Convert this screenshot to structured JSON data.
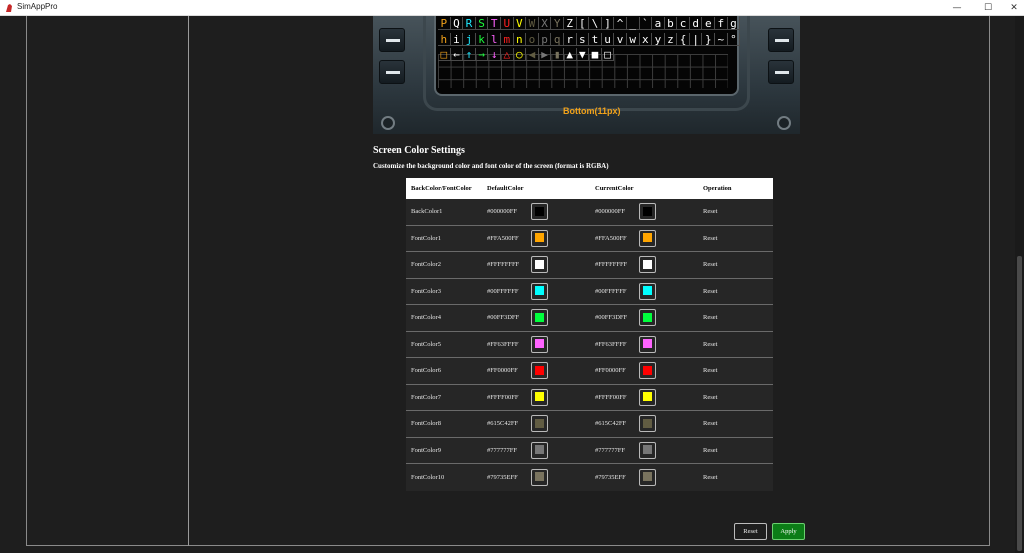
{
  "window": {
    "title": "SimAppPro",
    "min_symbol": "—",
    "max_symbol": "☐",
    "close_symbol": "✕"
  },
  "device": {
    "bottom_label": "Bottom(11px)",
    "char_rows": [
      [
        {
          "c": "P",
          "color": "#f2a21a"
        },
        {
          "c": "Q",
          "color": "#ffffff"
        },
        {
          "c": "R",
          "color": "#1fe8ff"
        },
        {
          "c": "S",
          "color": "#1cff3d"
        },
        {
          "c": "T",
          "color": "#ff63ff"
        },
        {
          "c": "U",
          "color": "#ff2020"
        },
        {
          "c": "V",
          "color": "#ffff00"
        },
        {
          "c": "W",
          "color": "#615c42"
        },
        {
          "c": "X",
          "color": "#777777"
        },
        {
          "c": "Y",
          "color": "#79735e"
        },
        {
          "c": "Z",
          "color": "#ffffff"
        },
        {
          "c": "[",
          "color": "#ffffff"
        },
        {
          "c": "\\",
          "color": "#ffffff"
        },
        {
          "c": "]",
          "color": "#ffffff"
        },
        {
          "c": "^",
          "color": "#ffffff"
        },
        {
          "c": "_",
          "color": "#ffffff"
        },
        {
          "c": "`",
          "color": "#ffffff"
        },
        {
          "c": "a",
          "color": "#ffffff"
        },
        {
          "c": "b",
          "color": "#ffffff"
        },
        {
          "c": "c",
          "color": "#ffffff"
        },
        {
          "c": "d",
          "color": "#ffffff"
        },
        {
          "c": "e",
          "color": "#ffffff"
        },
        {
          "c": "f",
          "color": "#ffffff"
        },
        {
          "c": "g",
          "color": "#ffffff"
        }
      ],
      [
        {
          "c": "h",
          "color": "#f2a21a"
        },
        {
          "c": "i",
          "color": "#ffffff"
        },
        {
          "c": "j",
          "color": "#1fe8ff"
        },
        {
          "c": "k",
          "color": "#1cff3d"
        },
        {
          "c": "l",
          "color": "#ff63ff"
        },
        {
          "c": "m",
          "color": "#ff2020"
        },
        {
          "c": "n",
          "color": "#ffff00"
        },
        {
          "c": "o",
          "color": "#615c42"
        },
        {
          "c": "p",
          "color": "#777777"
        },
        {
          "c": "q",
          "color": "#79735e"
        },
        {
          "c": "r",
          "color": "#ffffff"
        },
        {
          "c": "s",
          "color": "#ffffff"
        },
        {
          "c": "t",
          "color": "#ffffff"
        },
        {
          "c": "u",
          "color": "#ffffff"
        },
        {
          "c": "v",
          "color": "#ffffff"
        },
        {
          "c": "w",
          "color": "#ffffff"
        },
        {
          "c": "x",
          "color": "#ffffff"
        },
        {
          "c": "y",
          "color": "#ffffff"
        },
        {
          "c": "z",
          "color": "#ffffff"
        },
        {
          "c": "{",
          "color": "#ffffff"
        },
        {
          "c": "|",
          "color": "#ffffff"
        },
        {
          "c": "}",
          "color": "#ffffff"
        },
        {
          "c": "~",
          "color": "#ffffff"
        },
        {
          "c": "°",
          "color": "#ffffff"
        }
      ],
      [
        {
          "c": "□",
          "color": "#f2a21a"
        },
        {
          "c": "←",
          "color": "#ffffff"
        },
        {
          "c": "↑",
          "color": "#1fe8ff"
        },
        {
          "c": "→",
          "color": "#1cff3d"
        },
        {
          "c": "↓",
          "color": "#ff63ff"
        },
        {
          "c": "△",
          "color": "#ff2020"
        },
        {
          "c": "○",
          "color": "#ffff00"
        },
        {
          "c": "◀",
          "color": "#615c42"
        },
        {
          "c": "▶",
          "color": "#777777"
        },
        {
          "c": "▮",
          "color": "#79735e"
        },
        {
          "c": "▲",
          "color": "#ffffff"
        },
        {
          "c": "▼",
          "color": "#ffffff"
        },
        {
          "c": "■",
          "color": "#ffffff"
        },
        {
          "c": "□",
          "color": "#ffffff"
        }
      ]
    ]
  },
  "settings": {
    "title": "Screen Color Settings",
    "description": "Customize the background color and font color of the screen (format is RGBA)",
    "columns": [
      "BackColor/FontColor",
      "DefaultColor",
      "CurrentColor",
      "Operation"
    ],
    "rows": [
      {
        "name": "BackColor1",
        "default_hex": "#000000FF",
        "current_hex": "#000000FF",
        "swatch": "#000000",
        "op": "Reset"
      },
      {
        "name": "FontColor1",
        "default_hex": "#FFA500FF",
        "current_hex": "#FFA500FF",
        "swatch": "#ffa500",
        "op": "Reset"
      },
      {
        "name": "FontColor2",
        "default_hex": "#FFFFFFFF",
        "current_hex": "#FFFFFFFF",
        "swatch": "#ffffff",
        "op": "Reset"
      },
      {
        "name": "FontColor3",
        "default_hex": "#00FFFFFF",
        "current_hex": "#00FFFFFF",
        "swatch": "#00ffff",
        "op": "Reset"
      },
      {
        "name": "FontColor4",
        "default_hex": "#00FF3DFF",
        "current_hex": "#00FF3DFF",
        "swatch": "#00ff3d",
        "op": "Reset"
      },
      {
        "name": "FontColor5",
        "default_hex": "#FF63FFFF",
        "current_hex": "#FF63FFFF",
        "swatch": "#ff63ff",
        "op": "Reset"
      },
      {
        "name": "FontColor6",
        "default_hex": "#FF0000FF",
        "current_hex": "#FF0000FF",
        "swatch": "#ff0000",
        "op": "Reset"
      },
      {
        "name": "FontColor7",
        "default_hex": "#FFFF00FF",
        "current_hex": "#FFFF00FF",
        "swatch": "#ffff00",
        "op": "Reset"
      },
      {
        "name": "FontColor8",
        "default_hex": "#615C42FF",
        "current_hex": "#615C42FF",
        "swatch": "#615c42",
        "op": "Reset"
      },
      {
        "name": "FontColor9",
        "default_hex": "#777777FF",
        "current_hex": "#777777FF",
        "swatch": "#777777",
        "op": "Reset"
      },
      {
        "name": "FontColor10",
        "default_hex": "#79735EFF",
        "current_hex": "#79735EFF",
        "swatch": "#79735e",
        "op": "Reset"
      }
    ]
  },
  "actions": {
    "reset_label": "Reset",
    "apply_label": "Apply"
  }
}
